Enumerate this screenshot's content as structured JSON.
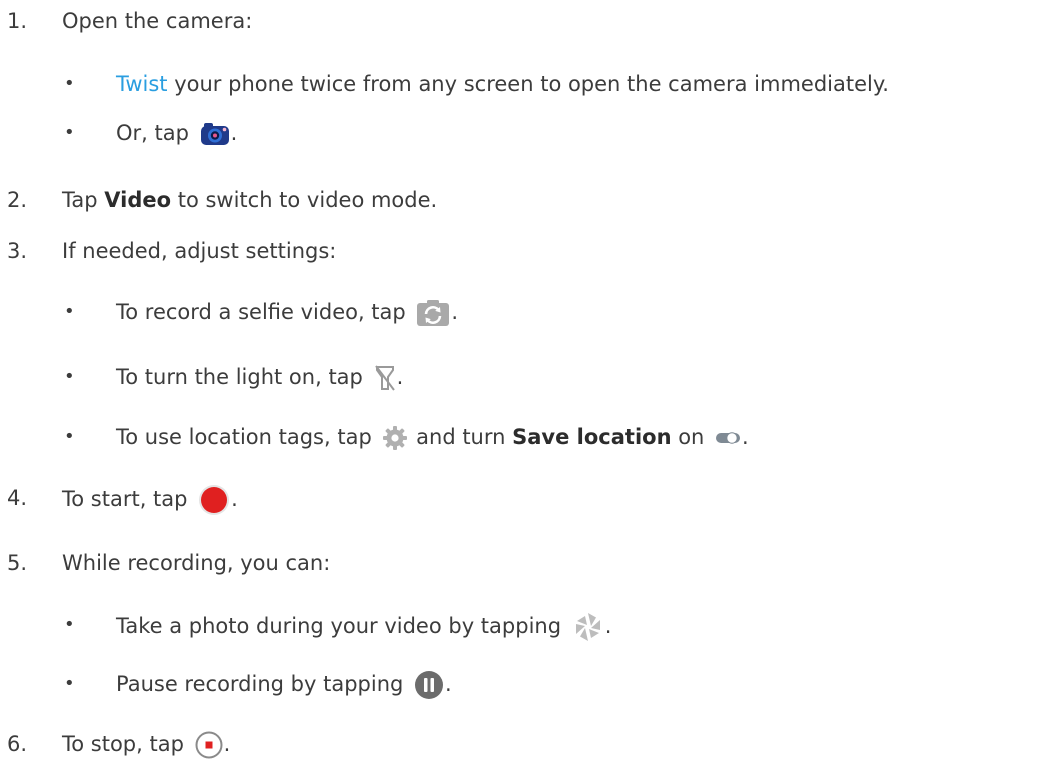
{
  "steps": [
    {
      "num": "1.",
      "text": "Open the camera:"
    },
    {
      "num": "2.",
      "pre": "Tap ",
      "bold": "Video",
      "post": " to switch to video mode."
    },
    {
      "num": "3.",
      "text": "If needed, adjust settings:"
    },
    {
      "num": "4.",
      "pre": "To start, tap ",
      "post": "."
    },
    {
      "num": "5.",
      "text": "While recording, you can:"
    },
    {
      "num": "6.",
      "pre": "To stop, tap ",
      "post": "."
    }
  ],
  "bullet_char": "•",
  "step1": {
    "twist_link": "Twist",
    "twist_rest": " your phone twice from any screen to open the camera immediately.",
    "or_tap_pre": "Or, tap ",
    "or_tap_post": "."
  },
  "step3": {
    "selfie_pre": "To record a selfie video, tap ",
    "selfie_post": ".",
    "light_pre": "To turn the light on, tap ",
    "light_post": ".",
    "loc_pre": "To use location tags, tap ",
    "loc_mid": " and turn ",
    "loc_bold": "Save location",
    "loc_on": " on ",
    "loc_post": "."
  },
  "step5": {
    "photo_pre": "Take a photo during your video by tapping ",
    "photo_post": ".",
    "pause_pre": "Pause recording by tapping ",
    "pause_post": "."
  },
  "icons": {
    "camera": "camera-app-icon",
    "selfie": "switch-camera-icon",
    "light": "flash-off-icon",
    "settings": "gear-icon",
    "toggle": "toggle-switch-icon",
    "record": "record-icon",
    "shutter": "shutter-icon",
    "pause": "pause-icon",
    "stop": "stop-icon"
  },
  "colors": {
    "text": "#3c3c3c",
    "link": "#2a9ee0",
    "record_red": "#e02020",
    "icon_gray": "#9a9a9a"
  }
}
